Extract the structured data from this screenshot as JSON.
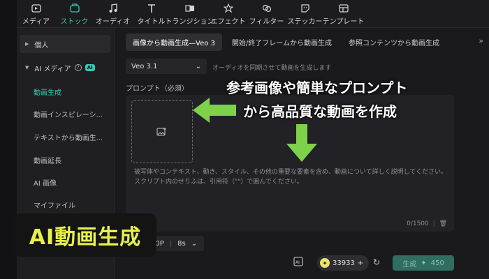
{
  "toolbar": {
    "items": [
      {
        "label": "メディア",
        "icon": "media-icon"
      },
      {
        "label": "ストック",
        "icon": "stock-icon",
        "active": true
      },
      {
        "label": "オーディオ",
        "icon": "music-note-icon"
      },
      {
        "label": "タイトル",
        "icon": "title-t-icon"
      },
      {
        "label": "トランジション",
        "icon": "transition-icon"
      },
      {
        "label": "エフェクト",
        "icon": "effect-star-icon"
      },
      {
        "label": "フィルター",
        "icon": "filter-icon"
      },
      {
        "label": "ステッカー",
        "icon": "sticker-icon"
      },
      {
        "label": "テンプレート",
        "icon": "template-icon"
      }
    ],
    "accent_color": "#36c9b4"
  },
  "sidebar": {
    "personal": "個人",
    "ai_media": "AI メディア",
    "ai_badge": "AI",
    "items": [
      "動画生成",
      "動画インスピレーシ...",
      "テキストから動画生...",
      "動画延長",
      "AI 画像",
      "マイファイル"
    ]
  },
  "tabs": {
    "items": [
      "画像から動画生成—Veo 3",
      "開始/終了フレームから動画生成",
      "参照コンテンツから動画生成"
    ],
    "more": "»"
  },
  "form": {
    "model": "Veo 3.1",
    "sync_text": "オーディオを同期させて動画を生成します",
    "prompt_label": "プロンプト（必須）",
    "placeholder_line1": "被写体やコンテキスト、動き、スタイル、その他の重要な要素を含め、動画について詳しく説明してください。",
    "placeholder_line2": "スクリプト内のせりふは、引用符（\"\"）で囲んでください。",
    "counter": "0/1500",
    "resolution": "80P",
    "duration": "8s",
    "credits": "33933",
    "generate_label": "生成",
    "generate_cost": "450"
  },
  "overlay": {
    "line1": "参考画像や簡単なプロンプト",
    "line2": "から高品質な動画を作成",
    "badge": "AI動画生成",
    "arrow_color": "#7ed14a",
    "badge_color": "#e8f24a"
  }
}
